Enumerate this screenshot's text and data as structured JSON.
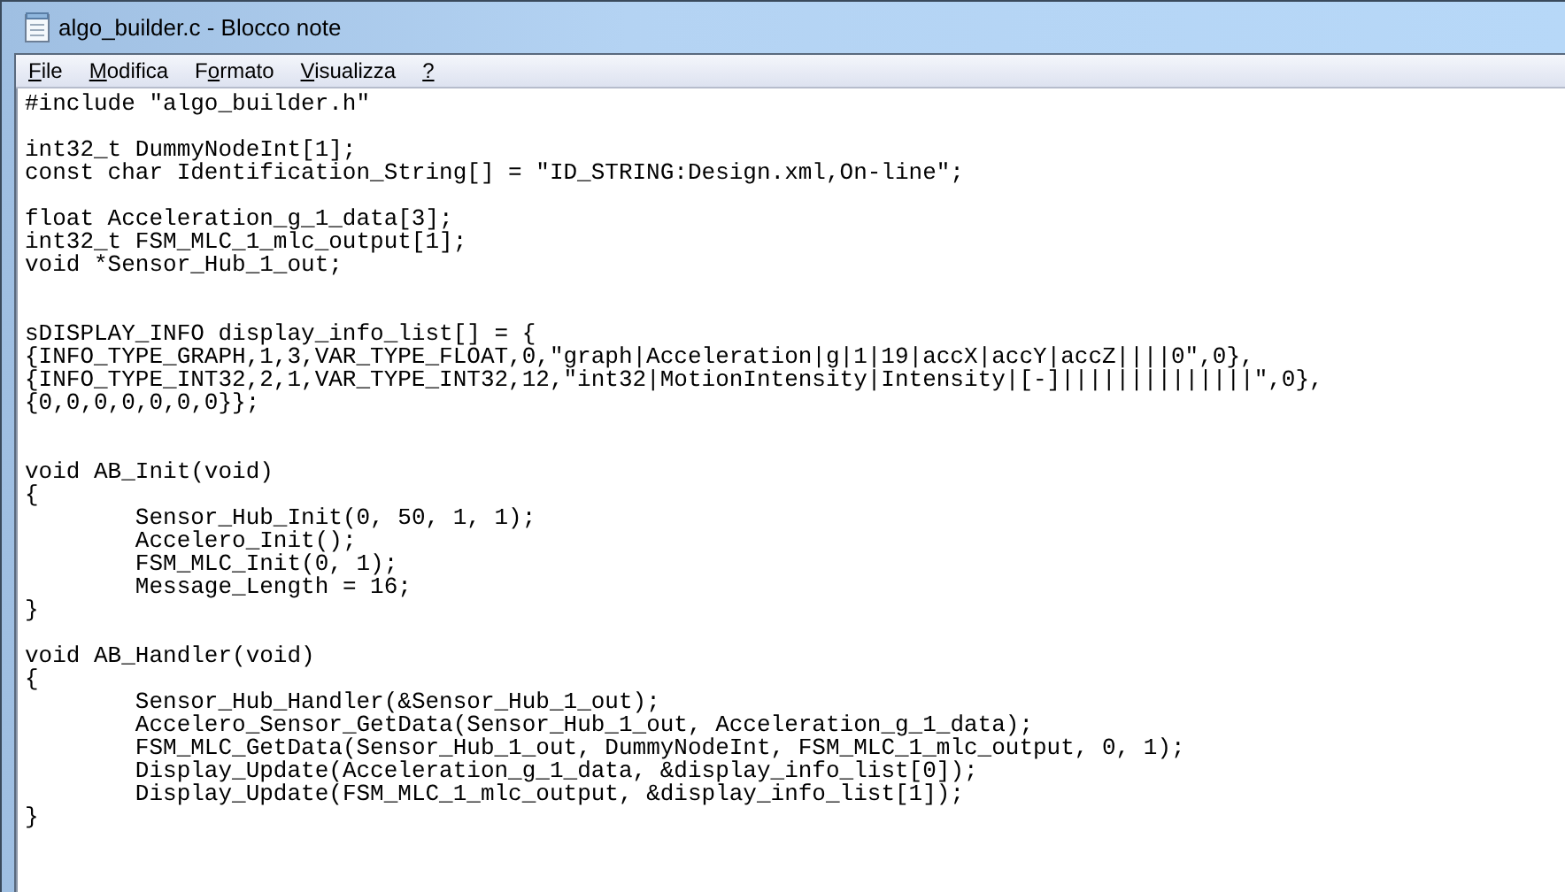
{
  "window": {
    "title": "algo_builder.c - Blocco note"
  },
  "menu": [
    {
      "key": "F",
      "after": "ile"
    },
    {
      "key": "M",
      "after": "odifica"
    },
    {
      "before": "F",
      "key": "o",
      "after": "rmato"
    },
    {
      "key": "V",
      "after": "isualizza"
    },
    {
      "key": "?"
    }
  ],
  "editor": {
    "value": "#include \"algo_builder.h\"\n\nint32_t DummyNodeInt[1];\nconst char Identification_String[] = \"ID_STRING:Design.xml,On-line\";\n\nfloat Acceleration_g_1_data[3];\nint32_t FSM_MLC_1_mlc_output[1];\nvoid *Sensor_Hub_1_out;\n\n\nsDISPLAY_INFO display_info_list[] = {\n{INFO_TYPE_GRAPH,1,3,VAR_TYPE_FLOAT,0,\"graph|Acceleration|g|1|19|accX|accY|accZ||||0\",0},\n{INFO_TYPE_INT32,2,1,VAR_TYPE_INT32,12,\"int32|MotionIntensity|Intensity|[-]||||||||||||||\",0},\n{0,0,0,0,0,0,0}};\n\n\nvoid AB_Init(void)\n{\n\tSensor_Hub_Init(0, 50, 1, 1);\n\tAccelero_Init();\n\tFSM_MLC_Init(0, 1);\n\tMessage_Length = 16;\n}\n\nvoid AB_Handler(void)\n{\n\tSensor_Hub_Handler(&Sensor_Hub_1_out);\n\tAccelero_Sensor_GetData(Sensor_Hub_1_out, Acceleration_g_1_data);\n\tFSM_MLC_GetData(Sensor_Hub_1_out, DummyNodeInt, FSM_MLC_1_mlc_output, 0, 1);\n\tDisplay_Update(Acceleration_g_1_data, &display_info_list[0]);\n\tDisplay_Update(FSM_MLC_1_mlc_output, &display_info_list[1]);\n}"
  }
}
